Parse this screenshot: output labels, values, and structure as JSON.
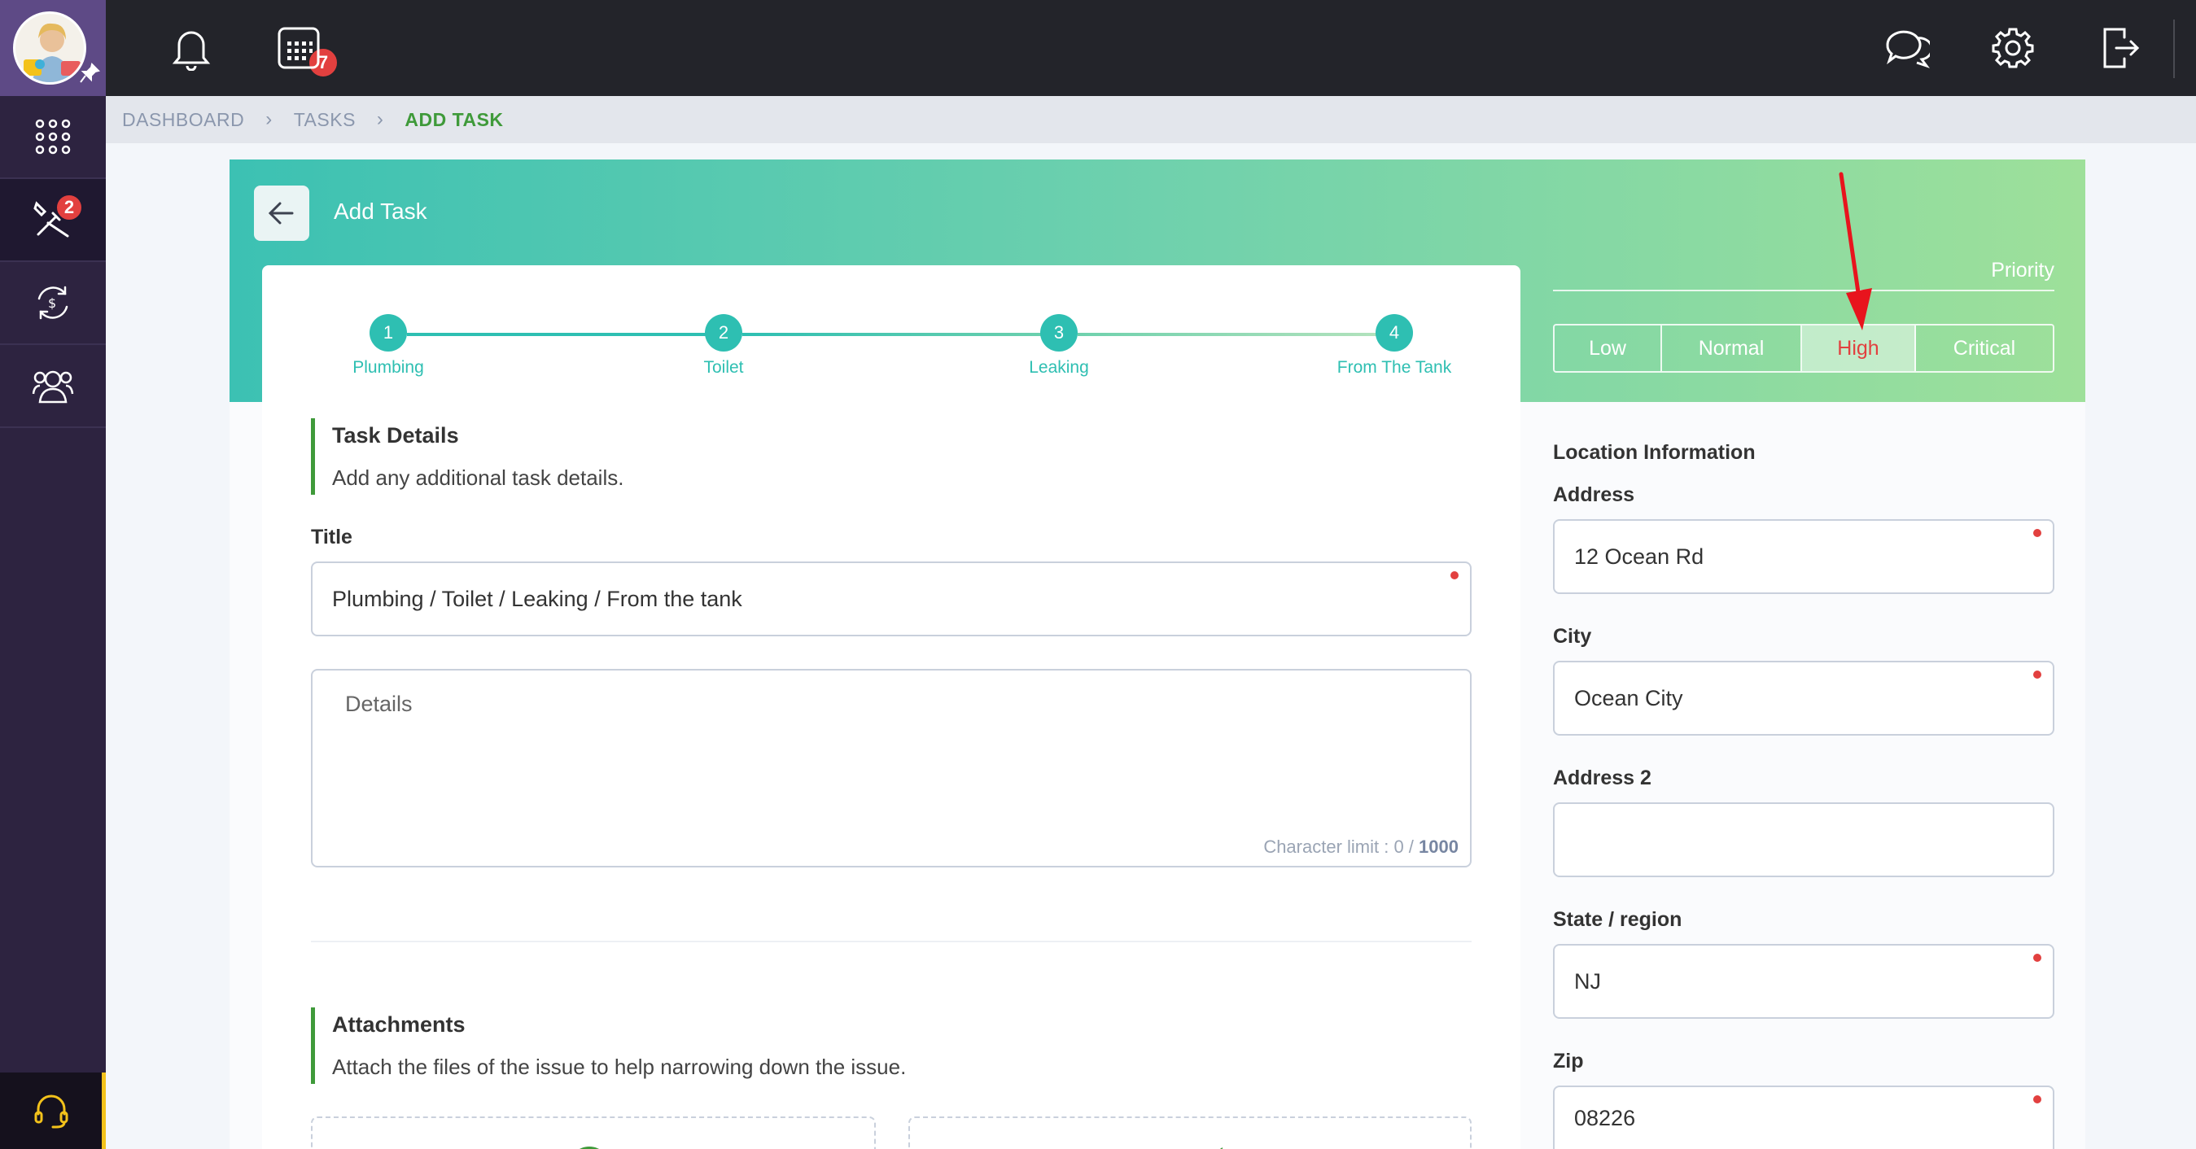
{
  "notifications": {
    "count": "7"
  },
  "sidebar": {
    "tasks_badge": "2"
  },
  "breadcrumb": {
    "items": [
      "DASHBOARD",
      "TASKS"
    ],
    "current": "ADD TASK"
  },
  "page": {
    "title": "Add Task"
  },
  "stepper": {
    "steps": [
      {
        "number": "1",
        "label": "Plumbing"
      },
      {
        "number": "2",
        "label": "Toilet"
      },
      {
        "number": "3",
        "label": "Leaking"
      },
      {
        "number": "4",
        "label": "From The Tank"
      }
    ]
  },
  "task_details": {
    "title": "Task Details",
    "subtitle": "Add any additional task details.",
    "title_label": "Title",
    "title_value": "Plumbing / Toilet / Leaking / From the tank",
    "details_placeholder": "Details",
    "char_limit_prefix": "Character limit : 0 /",
    "char_limit_max": "1000"
  },
  "attachments": {
    "title": "Attachments",
    "subtitle": "Attach the files of the issue to help narrowing down the issue."
  },
  "priority": {
    "label": "Priority",
    "options": [
      "Low",
      "Normal",
      "High",
      "Critical"
    ],
    "selected": "High"
  },
  "location": {
    "title": "Location Information",
    "address_label": "Address",
    "address_value": "12 Ocean Rd",
    "city_label": "City",
    "city_value": "Ocean City",
    "address2_label": "Address 2",
    "address2_value": "",
    "state_label": "State / region",
    "state_value": "NJ",
    "zip_label": "Zip",
    "zip_value": "08226"
  },
  "colors": {
    "accent_green": "#3f9a3a",
    "teal": "#2ebfb2",
    "badge_red": "#e2403f",
    "sidebar_bg": "#2d2340",
    "topbar_bg": "#23242a"
  }
}
